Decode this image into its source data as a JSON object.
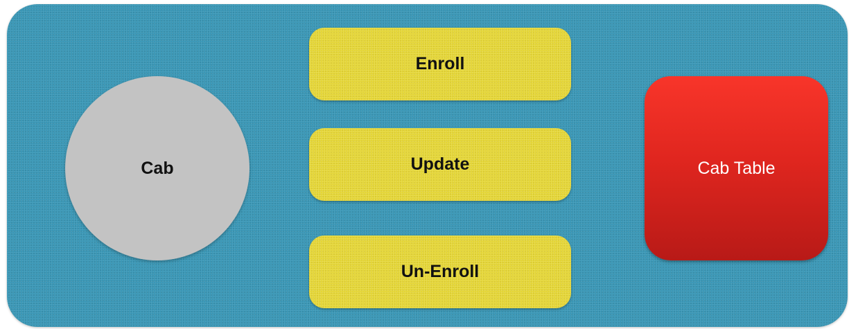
{
  "actor": {
    "label": "Cab"
  },
  "actions": [
    {
      "label": "Enroll"
    },
    {
      "label": "Update"
    },
    {
      "label": "Un-Enroll"
    }
  ],
  "target": {
    "label": "Cab Table"
  },
  "colors": {
    "panel": "#3a97b6",
    "actor": "#c3c3c3",
    "action": "#e4d535",
    "target": "#e0261f"
  }
}
